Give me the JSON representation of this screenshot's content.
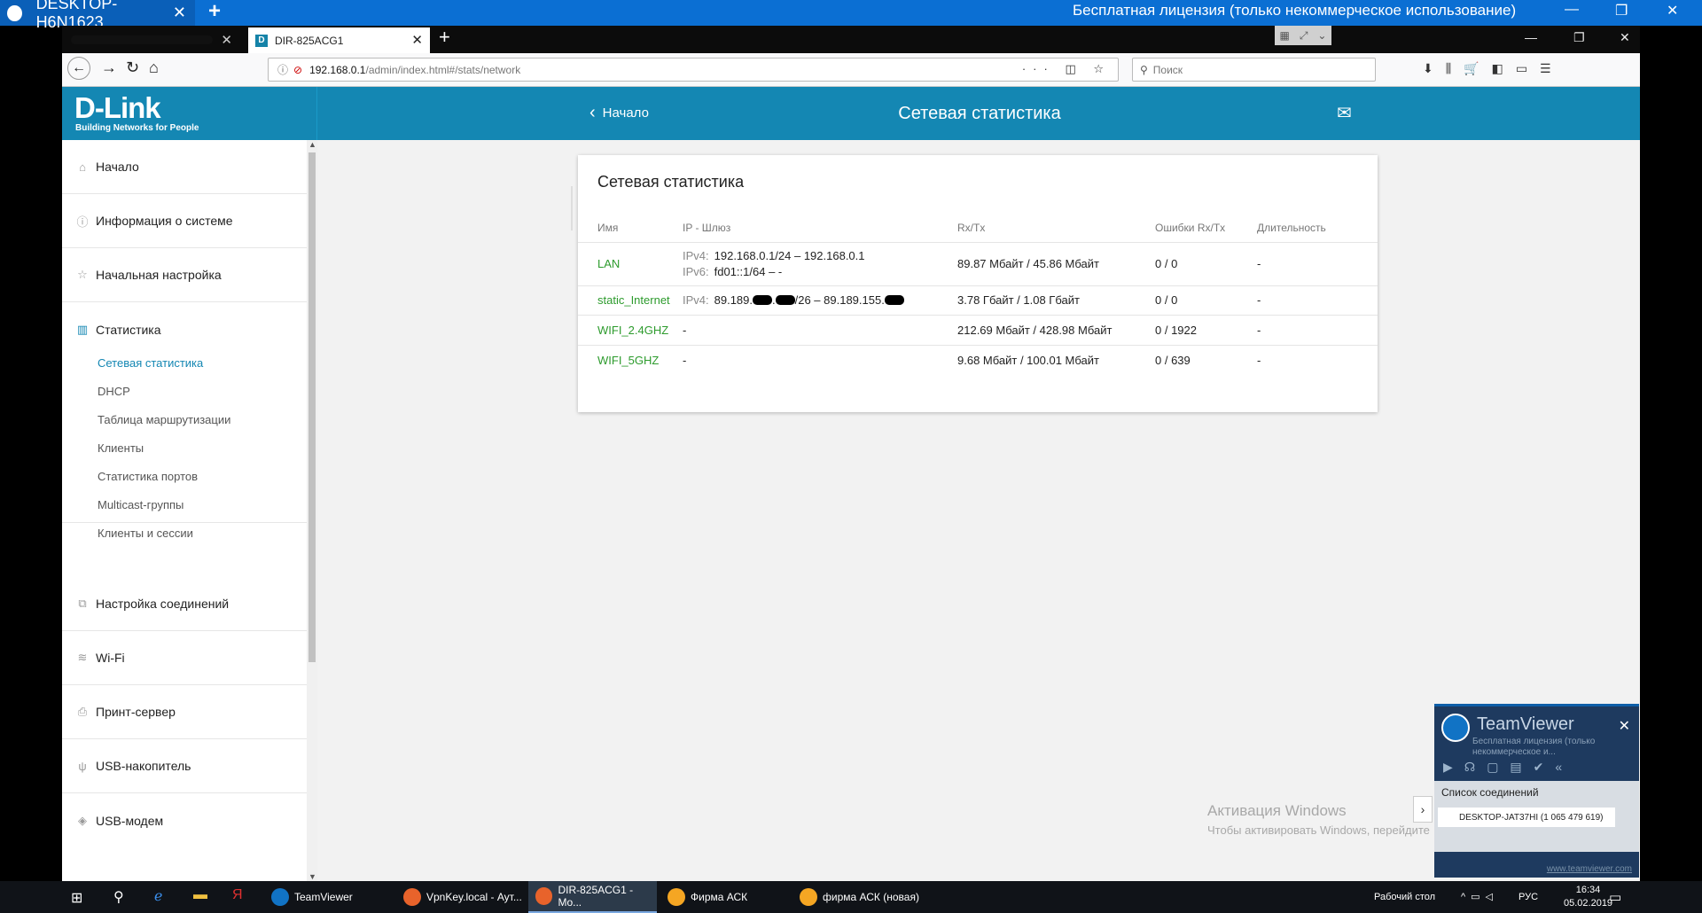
{
  "teamviewer_bar": {
    "tab_title": "DESKTOP-H6N1623",
    "license_text": "Бесплатная лицензия (только некоммерческое использование)"
  },
  "browser": {
    "tab_title": "DIR-825ACG1",
    "tab_favicon": "D",
    "url_host": "192.168.0.1",
    "url_path": "/admin/index.html#/stats/network",
    "search_placeholder": "Поиск"
  },
  "header": {
    "logo": "D-Link",
    "logo_tagline": "Building Networks for People",
    "back_label": "Начало",
    "title": "Сетевая статистика"
  },
  "sidebar": {
    "items": [
      {
        "label": "Начало",
        "icon": "home-icon",
        "glyph": "⌂"
      },
      {
        "label": "Информация о системе",
        "icon": "info-icon",
        "glyph": "ⓘ"
      },
      {
        "label": "Начальная настройка",
        "icon": "wizard-icon",
        "glyph": "☆"
      },
      {
        "label": "Статистика",
        "icon": "stats-icon",
        "glyph": "▥"
      },
      {
        "label": "Настройка соединений",
        "icon": "connections-icon",
        "glyph": "⧉"
      },
      {
        "label": "Wi-Fi",
        "icon": "wifi-icon",
        "glyph": "≋"
      },
      {
        "label": "Принт-сервер",
        "icon": "printer-icon",
        "glyph": "⎙"
      },
      {
        "label": "USB-накопитель",
        "icon": "usb-icon",
        "glyph": "ψ"
      },
      {
        "label": "USB-модем",
        "icon": "modem-icon",
        "glyph": "◈"
      }
    ],
    "subitems": [
      {
        "label": "Сетевая статистика",
        "selected": true
      },
      {
        "label": "DHCP"
      },
      {
        "label": "Таблица маршрутизации"
      },
      {
        "label": "Клиенты"
      },
      {
        "label": "Статистика портов"
      },
      {
        "label": "Multicast-группы"
      },
      {
        "label": "Клиенты и сессии"
      }
    ]
  },
  "card": {
    "title": "Сетевая статистика",
    "columns": [
      "Имя",
      "IP - Шлюз",
      "Rx/Tx",
      "Ошибки Rx/Tx",
      "Длительность"
    ],
    "ipv4_label": "IPv4:",
    "ipv6_label": "IPv6:",
    "rows": [
      {
        "name": "LAN",
        "ipv4": "192.168.0.1/24 – 192.168.0.1",
        "ipv6": "fd01::1/64 –  -",
        "rxtx": "89.87 Мбайт / 45.86 Мбайт",
        "errors": "0 / 0",
        "duration": "-"
      },
      {
        "name": "static_Internet",
        "ipv4_a": "89.189.",
        "ipv4_b": "/26 – 89.189.155.",
        "rxtx": "3.78 Гбайт / 1.08 Гбайт",
        "errors": "0 / 0",
        "duration": "-"
      },
      {
        "name": "WIFI_2.4GHZ",
        "ip": "-",
        "rxtx": "212.69 Мбайт / 428.98 Мбайт",
        "errors": "0 / 1922",
        "duration": "-"
      },
      {
        "name": "WIFI_5GHZ",
        "ip": "-",
        "rxtx": "9.68 Мбайт / 100.01 Мбайт",
        "errors": "0 / 639",
        "duration": "-"
      }
    ]
  },
  "watermark": {
    "line1": "Активация Windows",
    "line2": "Чтобы активировать Windows, перейдите"
  },
  "teamviewer_panel": {
    "name": "TeamViewer",
    "license": "Бесплатная лицензия (только некоммерческое и...",
    "list_header": "Список соединений",
    "connection": "DESKTOP-JAT37HI (1 065 479 619)",
    "url": "www.teamviewer.com"
  },
  "taskbar": {
    "apps": [
      {
        "label": "TeamViewer",
        "color": "#1173c5"
      },
      {
        "label": "VpnKey.local - Аут...",
        "color": "#e8632b"
      },
      {
        "label": "DIR-825ACG1 - Mo...",
        "color": "#e8632b",
        "active": true
      },
      {
        "label": "Фирма АСК",
        "color": "#f5a623"
      },
      {
        "label": "фирма АСК (новая)",
        "color": "#f5a623"
      }
    ],
    "desktop_label": "Рабочий стол",
    "lang": "РУС",
    "time": "16:34",
    "date": "05.02.2019"
  }
}
